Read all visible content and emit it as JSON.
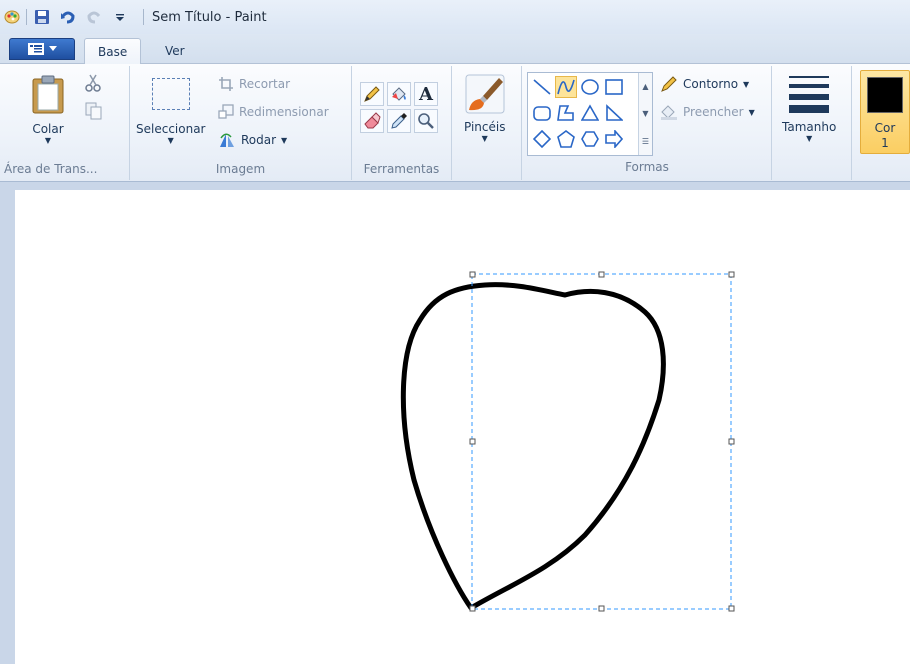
{
  "window": {
    "title": "Sem Título - Paint"
  },
  "tabs": [
    {
      "label": "Base"
    },
    {
      "label": "Ver"
    }
  ],
  "ribbon": {
    "clipboard": {
      "paste_label": "Colar",
      "group_label": "Área de Trans..."
    },
    "image": {
      "select_label": "Seleccionar",
      "crop_label": "Recortar",
      "resize_label": "Redimensionar",
      "rotate_label": "Rodar",
      "group_label": "Imagem"
    },
    "tools": {
      "group_label": "Ferramentas"
    },
    "brushes": {
      "label": "Pincéis"
    },
    "shapes": {
      "outline_label": "Contorno",
      "fill_label": "Preencher",
      "group_label": "Formas"
    },
    "size": {
      "label": "Tamanho"
    },
    "color1": {
      "label_line1": "Cor",
      "label_line2": "1",
      "color": "#000000"
    }
  },
  "colors": {
    "accent": "#1f4fa0",
    "selection": "#fbce62",
    "canvas": "#ffffff",
    "workspace": "#c9d6e8"
  }
}
